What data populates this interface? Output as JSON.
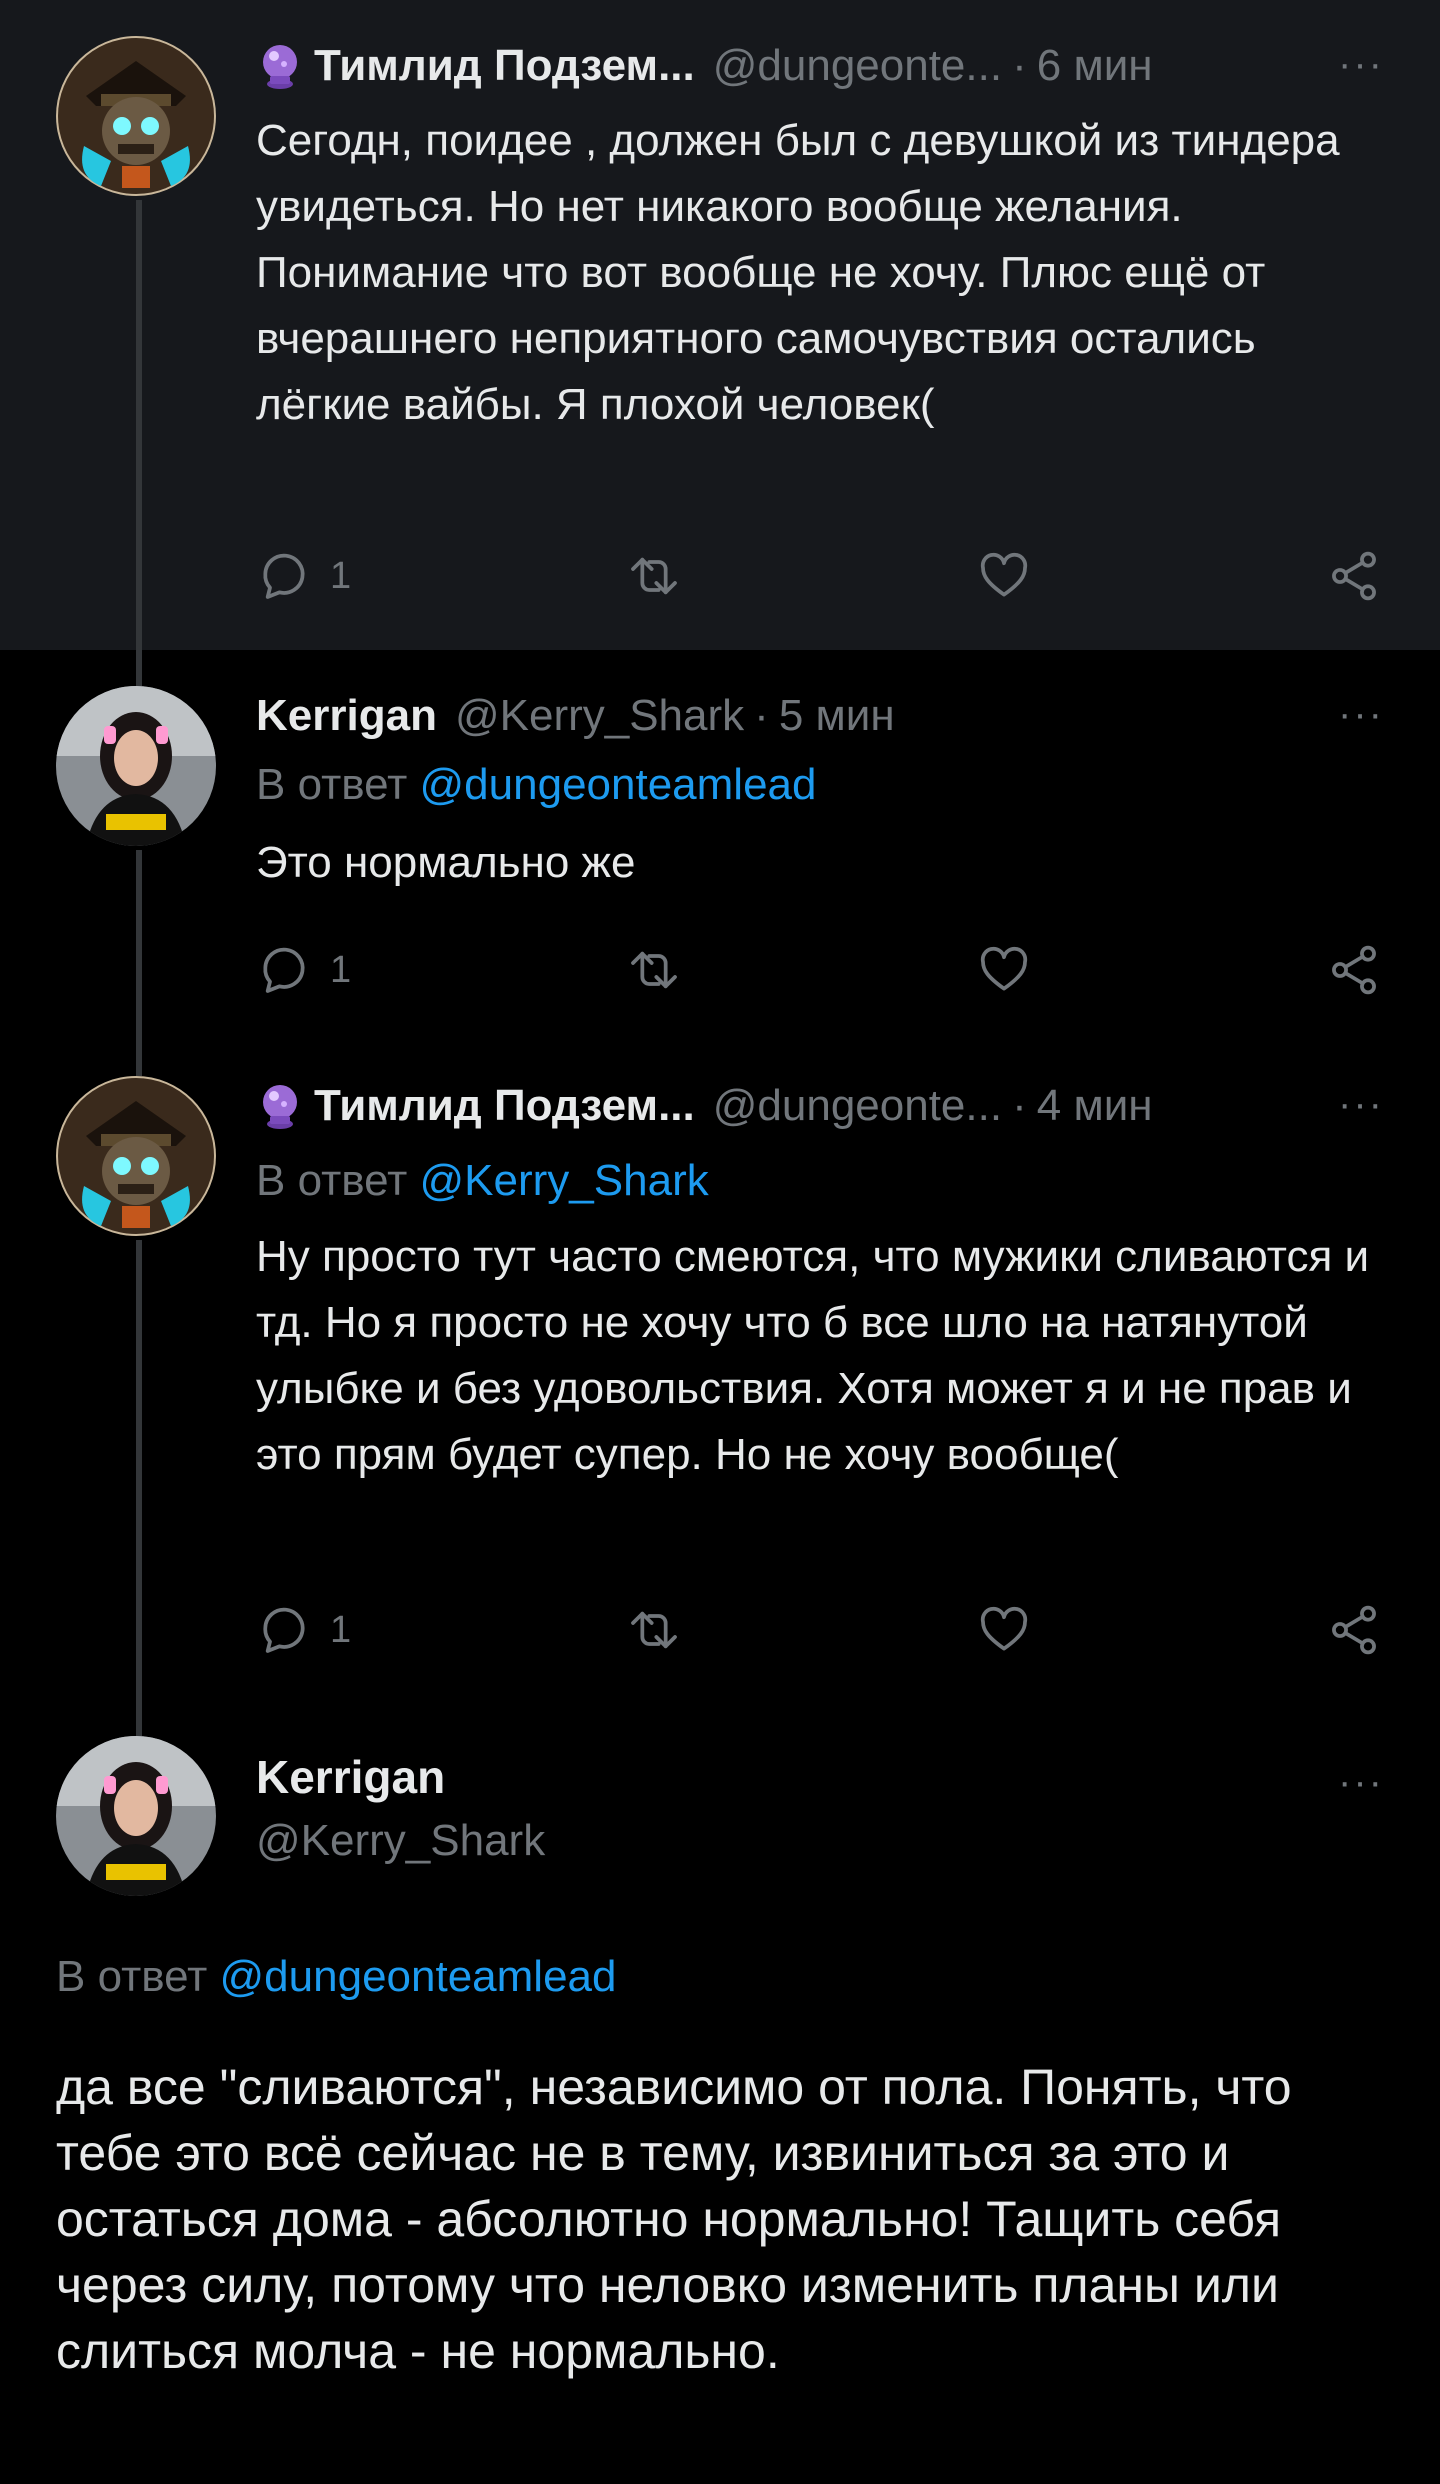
{
  "colors": {
    "background": "#000000",
    "highlight_background": "#16181c",
    "text_primary": "#e7e9ea",
    "text_secondary": "#71767b",
    "link": "#1d9bf0",
    "thread_line": "#333639"
  },
  "tweets": [
    {
      "author_name": "Тимлид Подзем...",
      "author_emoji_icon": "crystal-ball-icon",
      "handle": "@dungeonte...",
      "dot": "·",
      "time": "6 мин",
      "more": "···",
      "reply_to": null,
      "body": "Сегодн, поидее , должен был с девушкой из тиндера увидеться. Но нет никакого вообще желания. Понимание что вот вообще не хочу. Плюс ещё от вчерашнего неприятного самочувствия остались лёгкие вайбы. Я плохой человек(",
      "reply_count": "1"
    },
    {
      "author_name": "Kerrigan",
      "handle": "@Kerry_Shark",
      "dot": "·",
      "time": "5 мин",
      "more": "···",
      "reply_prefix": "В ответ",
      "reply_to": "@dungeonteamlead",
      "body": "Это нормально же",
      "reply_count": "1"
    },
    {
      "author_name": "Тимлид Подзем...",
      "author_emoji_icon": "crystal-ball-icon",
      "handle": "@dungeonte...",
      "dot": "·",
      "time": "4 мин",
      "more": "···",
      "reply_prefix": "В ответ",
      "reply_to": "@Kerry_Shark",
      "body": "Ну просто тут часто смеются, что мужики сливаются и тд. Но я просто не хочу что б все шло на натянутой улыбке и без удовольствия. Хотя может я и не прав и это прям будет супер. Но не хочу вообще(",
      "reply_count": "1"
    },
    {
      "author_name": "Kerrigan",
      "handle": "@Kerry_Shark",
      "more": "···",
      "reply_prefix": "В ответ",
      "reply_to": "@dungeonteamlead",
      "body": "да все \"сливаются\", независимо от пола. Понять, что тебе это всё сейчас не в тему, извиниться за это и остаться дома - абсолютно нормально! Тащить себя через силу, потому что неловко изменить планы или слиться молча - не нормально."
    }
  ]
}
